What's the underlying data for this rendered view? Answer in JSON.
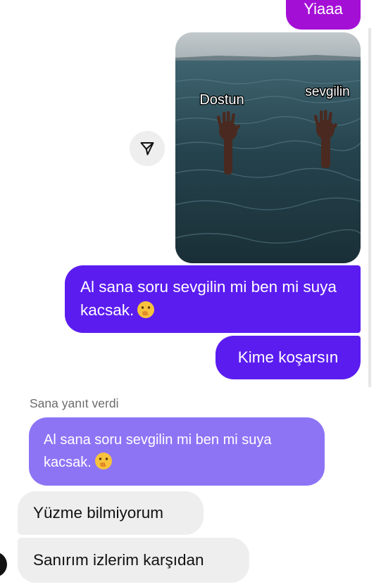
{
  "messages": {
    "sent_top": "Yiaaa",
    "image_labels": {
      "left": "Dostun",
      "right": "sevgilin"
    },
    "sent_long": "Al sana soru sevgilin mi ben mi suya kacsak.",
    "sent_short": "Kime koşarsın"
  },
  "reply": {
    "label": "Sana yanıt verdi",
    "quoted_text": "Al sana soru sevgilin mi ben mi suya kacsak."
  },
  "received": [
    "Yüzme bilmiyorum",
    "Sanırım izlerim karşıdan"
  ],
  "emoji": "face-with-hand-over-mouth",
  "colors": {
    "sent_bubble": "#5b1cf0",
    "sent_top_bubble": "#a40fd6",
    "quoted_bubble": "#8d74f5",
    "received_bubble": "#eeeeee"
  }
}
